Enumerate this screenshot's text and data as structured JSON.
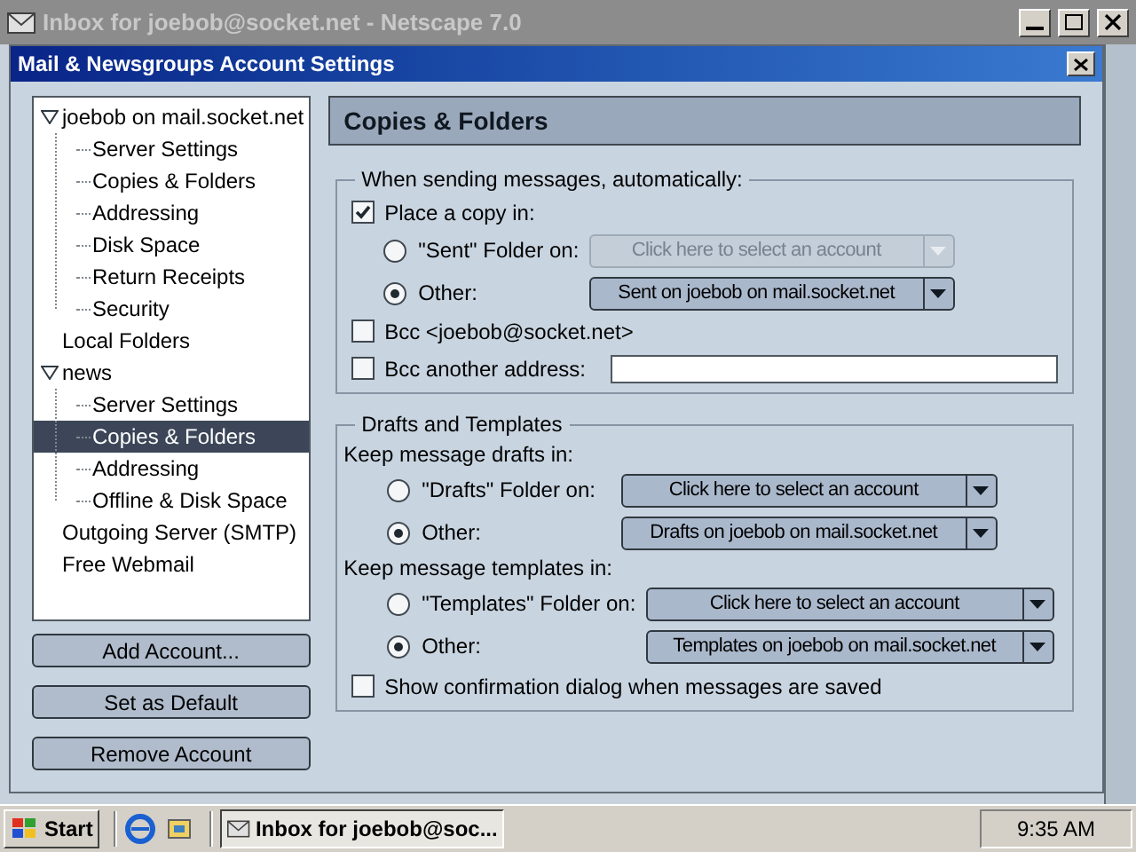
{
  "main_window": {
    "title": "Inbox for joebob@socket.net - Netscape 7.0"
  },
  "dialog": {
    "title": "Mail & Newsgroups Account Settings"
  },
  "account_tree": [
    {
      "label": "joebob on mail.socket.net",
      "selected": false,
      "expanded": true,
      "children": [
        {
          "label": "Server Settings",
          "selected": false
        },
        {
          "label": "Copies & Folders",
          "selected": false
        },
        {
          "label": "Addressing",
          "selected": false
        },
        {
          "label": "Disk Space",
          "selected": false
        },
        {
          "label": "Return Receipts",
          "selected": false
        },
        {
          "label": "Security",
          "selected": false
        }
      ]
    },
    {
      "label": "Local Folders",
      "selected": false
    },
    {
      "label": "news",
      "selected": false,
      "expanded": true,
      "children": [
        {
          "label": "Server Settings",
          "selected": false
        },
        {
          "label": "Copies & Folders",
          "selected": true
        },
        {
          "label": "Addressing",
          "selected": false
        },
        {
          "label": "Offline & Disk Space",
          "selected": false
        }
      ]
    },
    {
      "label": "Outgoing Server (SMTP)",
      "selected": false
    },
    {
      "label": "Free Webmail",
      "selected": false
    }
  ],
  "account_buttons": [
    "Add Account...",
    "Set as Default",
    "Remove Account"
  ],
  "panel_title": "Copies & Folders",
  "sending_group": {
    "legend": "When sending messages, automatically:",
    "place_copy": {
      "label": "Place a copy in:",
      "checked": true
    },
    "radios": [
      {
        "label": "\"Sent\" Folder on:",
        "selected": false,
        "dropdown": {
          "value": "Click here to select an account",
          "disabled": true
        }
      },
      {
        "label": "Other:",
        "selected": true,
        "dropdown": {
          "value": "Sent on joebob on mail.socket.net",
          "disabled": false
        }
      }
    ],
    "bcc_self": {
      "label": "Bcc <joebob@socket.net>",
      "checked": false
    },
    "bcc_other": {
      "label": "Bcc another address:",
      "checked": false
    }
  },
  "drafts_group": {
    "legend": "Drafts and Templates",
    "sections": [
      {
        "heading": "Keep message drafts in:",
        "radios": [
          {
            "label": "\"Drafts\" Folder on:",
            "selected": false,
            "dropdown": {
              "value": "Click here to select an account",
              "disabled": false
            }
          },
          {
            "label": "Other:",
            "selected": true,
            "dropdown": {
              "value": "Drafts on joebob on mail.socket.net",
              "disabled": false
            }
          }
        ]
      },
      {
        "heading": "Keep message templates in:",
        "radios": [
          {
            "label": "\"Templates\" Folder on:",
            "selected": false,
            "dropdown": {
              "value": "Click here to select an account",
              "disabled": false
            }
          },
          {
            "label": "Other:",
            "selected": true,
            "dropdown": {
              "value": "Templates on joebob on mail.socket.net",
              "disabled": false
            }
          }
        ]
      }
    ],
    "confirm": {
      "label": "Show confirmation dialog when messages are saved",
      "checked": false
    }
  },
  "taskbar": {
    "start": "Start",
    "task": "Inbox for joebob@soc...",
    "clock": "9:35 AM"
  }
}
